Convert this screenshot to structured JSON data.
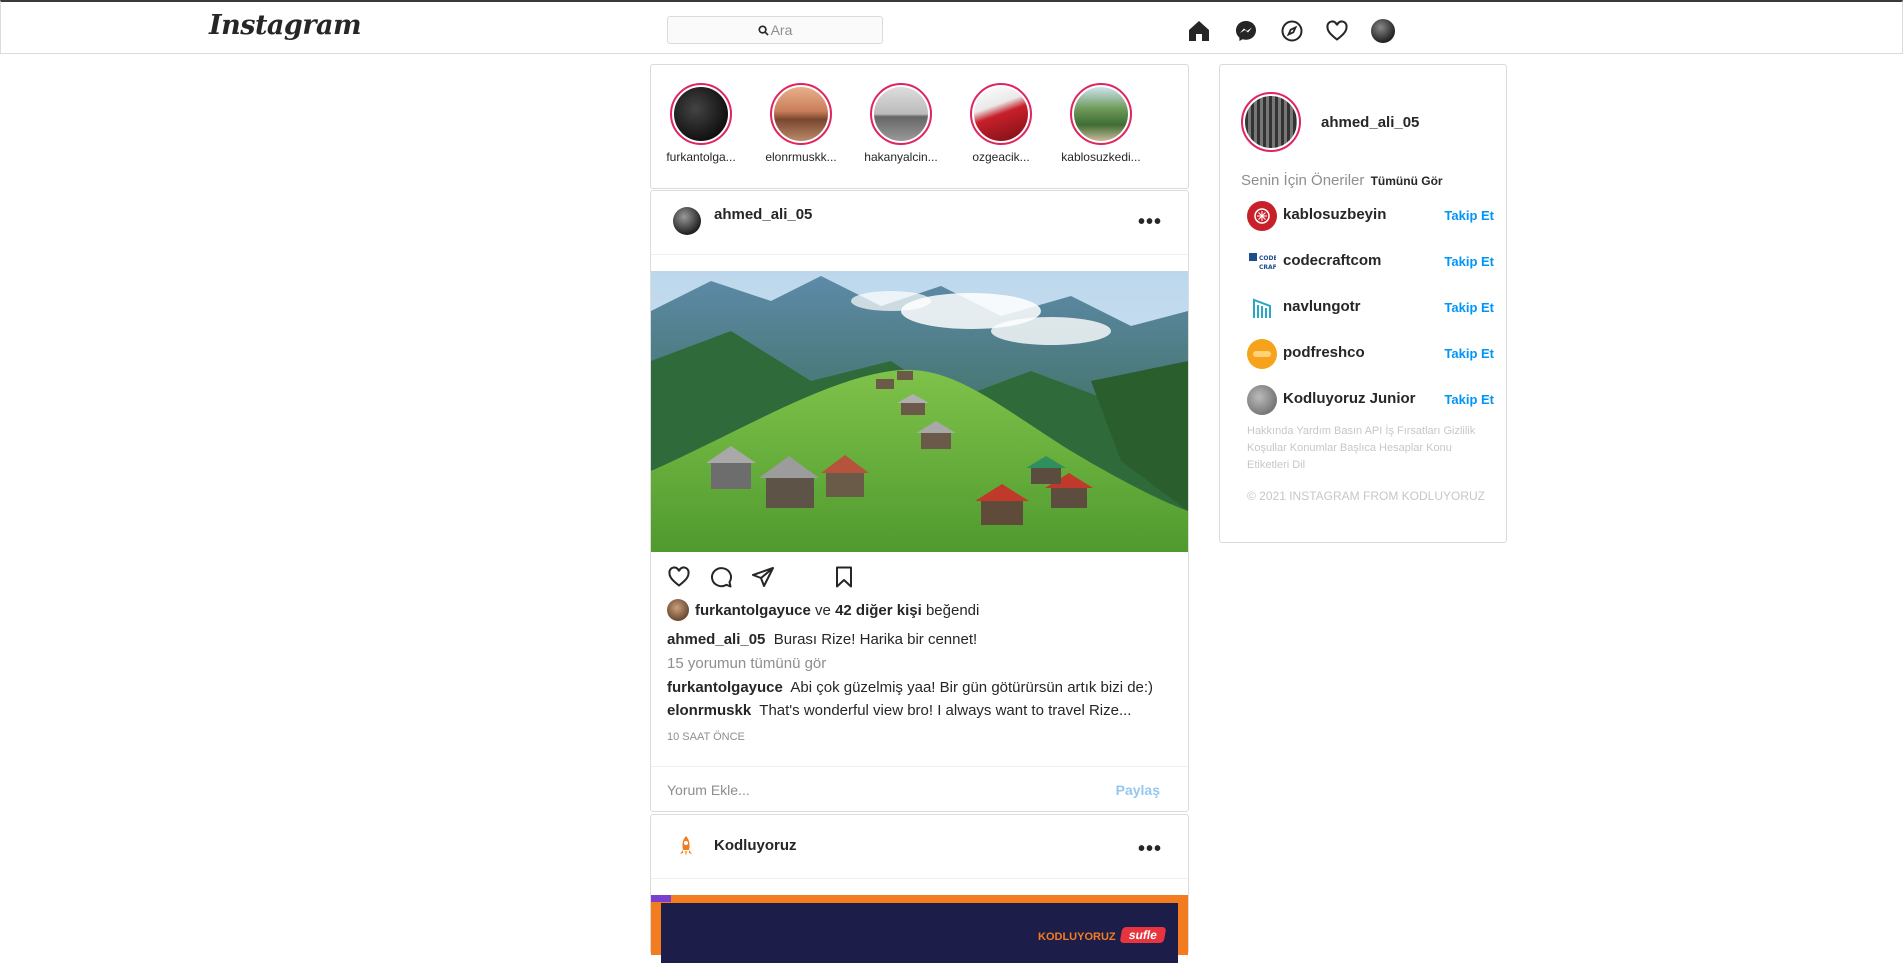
{
  "header": {
    "logo": "Instagram",
    "search_placeholder": "Ara",
    "nav_icons": [
      "home-icon",
      "messenger-icon",
      "explore-icon",
      "heart-icon",
      "profile-avatar"
    ]
  },
  "stories": [
    {
      "name": "furkantolga..."
    },
    {
      "name": "elonrmuskk..."
    },
    {
      "name": "hakanyalcin..."
    },
    {
      "name": "ozgeacik..."
    },
    {
      "name": "kablosuzkedi..."
    }
  ],
  "post": {
    "username": "ahmed_ali_05",
    "liked_by_user": "furkantolgayuce",
    "liked_by_joiner": "ve",
    "liked_by_others": "42 diğer kişi",
    "liked_suffix": "beğendi",
    "caption_user": "ahmed_ali_05",
    "caption_text": "Burası Rize! Harika bir cennet!",
    "view_comments": "15 yorumun tümünü gör",
    "comments": [
      {
        "user": "furkantolgayuce",
        "text": "Abi çok güzelmiş yaa! Bir gün götürürsün artık bizi de:)"
      },
      {
        "user": "elonrmuskk",
        "text": "That's wonderful view bro! I always want to travel Rize..."
      }
    ],
    "time": "10 SAAT ÖNCE",
    "comment_placeholder": "Yorum Ekle...",
    "share_label": "Paylaş"
  },
  "post2": {
    "username": "Kodluyoruz",
    "banner_text": "KODLUYORUZ",
    "banner_badge": "sufle"
  },
  "sidebar": {
    "username": "ahmed_ali_05",
    "suggestions_title": "Senin İçin Öneriler",
    "see_all": "Tümünü Gör",
    "suggestions": [
      {
        "name": "kablosuzbeyin",
        "action": "Takip Et"
      },
      {
        "name": "codecraftcom",
        "action": "Takip Et"
      },
      {
        "name": "navlungotr",
        "action": "Takip Et"
      },
      {
        "name": "podfreshco",
        "action": "Takip Et"
      },
      {
        "name": "Kodluyoruz Junior",
        "action": "Takip Et"
      }
    ],
    "footer_links": "Hakkında Yardım Basın API İş Fırsatları Gizlilik Koşullar Konumlar Başlıca Hesaplar Konu Etiketleri Dil",
    "copyright": "© 2021 INSTAGRAM FROM KODLUYORUZ"
  },
  "colors": {
    "story_ring": "#e0245e",
    "follow_blue": "#0095f6",
    "share_disabled": "#95c8f0",
    "border": "#dbdbdb"
  }
}
